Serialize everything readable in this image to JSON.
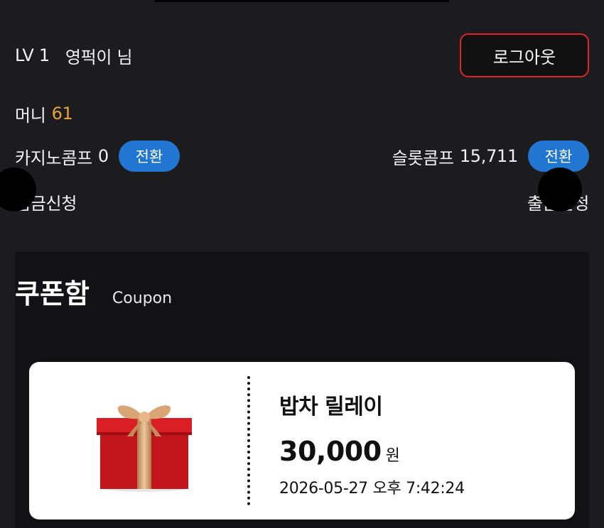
{
  "user": {
    "level": "LV 1",
    "name": "영퍽이 님",
    "logout_label": "로그아웃"
  },
  "money": {
    "label": "머니",
    "value": "61"
  },
  "comp": {
    "casino_label": "카지노콤프",
    "casino_value": "0",
    "slot_label": "슬롯콤프",
    "slot_value": "15,711",
    "convert_label": "전환"
  },
  "bank": {
    "deposit_label": "입금신청",
    "withdraw_label": "출금신청"
  },
  "coupon": {
    "title": "쿠폰함",
    "subtitle": "Coupon",
    "items": [
      {
        "name": "밥차 릴레이",
        "amount": "30,000",
        "unit": "원",
        "date": "2026-05-27 오후 7:42:24",
        "icon": "gift-box-icon"
      }
    ]
  },
  "colors": {
    "accent_gold": "#e5a33a",
    "button_blue": "#2176d2",
    "logout_border": "#e0252a"
  }
}
